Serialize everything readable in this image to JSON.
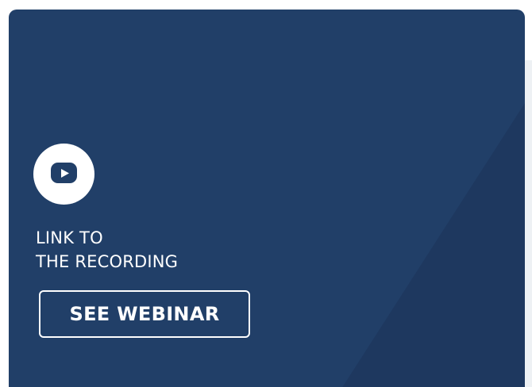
{
  "card": {
    "title_line1": "LINK TO",
    "title_line2": "THE RECORDING",
    "button_label": "SEE WEBINAR",
    "icon": "youtube-play-icon"
  },
  "colors": {
    "card_background": "#213f68",
    "diagonal_shade": "#1e385f",
    "text": "#ffffff",
    "page_background": "#ffffff"
  }
}
